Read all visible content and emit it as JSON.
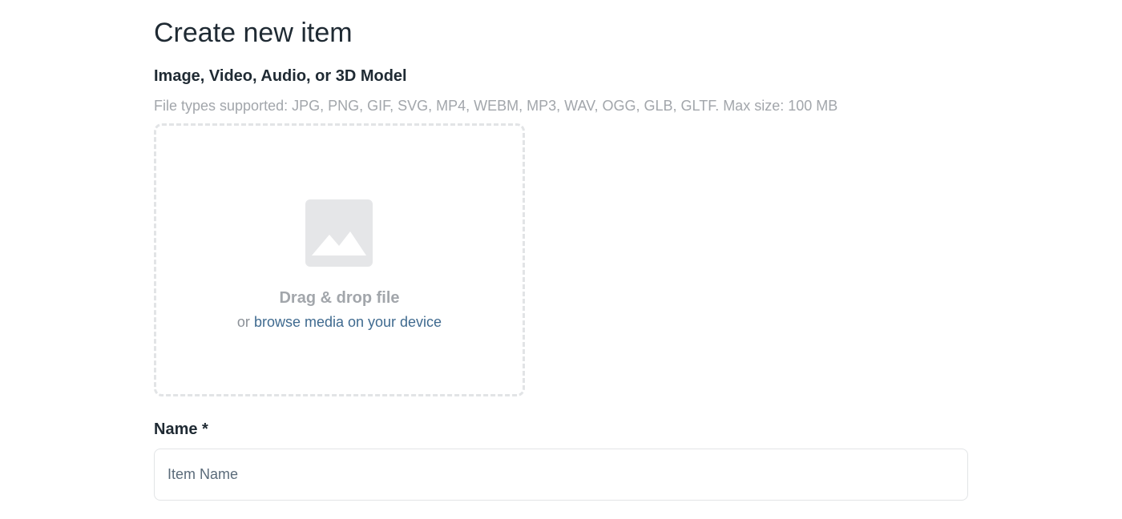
{
  "page": {
    "title": "Create new item"
  },
  "media": {
    "label": "Image, Video, Audio, or 3D Model",
    "hint": "File types supported: JPG, PNG, GIF, SVG, MP4, WEBM, MP3, WAV, OGG, GLB, GLTF. Max size: 100 MB",
    "dropzone": {
      "icon": "image-placeholder-icon",
      "title": "Drag & drop file",
      "prefix": "or ",
      "link": "browse media on your device"
    }
  },
  "name_field": {
    "label": "Name *",
    "value": "",
    "placeholder": "Item Name"
  },
  "colors": {
    "text": "#1f2a33",
    "muted": "#a2a6ab",
    "link": "#3f6a8f",
    "border": "#e2e4e6",
    "icon_bg": "#e5e6e8"
  }
}
